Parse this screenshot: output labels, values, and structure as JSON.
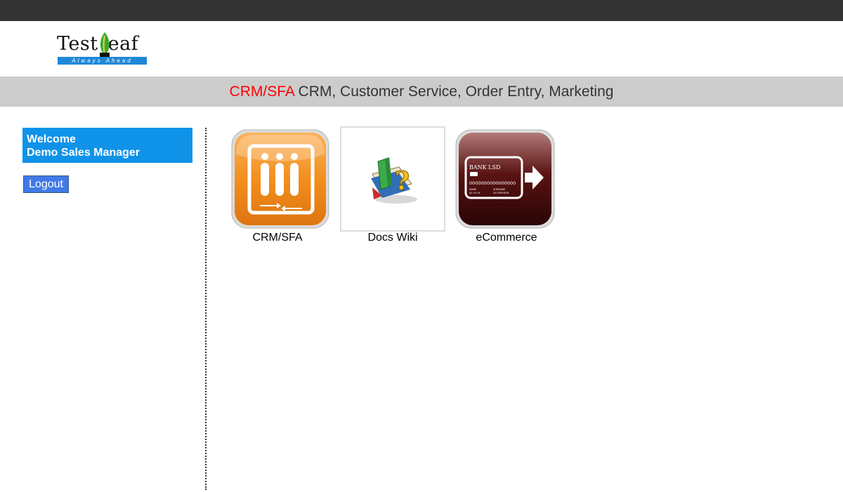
{
  "logo": {
    "word": "TestLeaf",
    "word_before_leaf": "Test",
    "word_after_leaf": "eaf",
    "tagline": "Always Ahead"
  },
  "banner": {
    "highlight": "CRM/SFA",
    "rest": " CRM, Customer Service, Order Entry, Marketing",
    "highlight_color": "#ff0000"
  },
  "sidebar": {
    "welcome_line1": "Welcome",
    "welcome_line2": "Demo Sales Manager",
    "logout_label": "Logout",
    "welcome_bg": "#0f93e8",
    "logout_bg": "#4179e7"
  },
  "apps": [
    {
      "label": "CRM/SFA",
      "icon": "crm-sfa-icon",
      "color": "#f08c1b"
    },
    {
      "label": "Docs Wiki",
      "icon": "docs-wiki-icon",
      "color": "#ffffff"
    },
    {
      "label": "eCommerce",
      "icon": "ecommerce-icon",
      "color": "#6b1a1a",
      "card": {
        "bank": "BANK LSD",
        "number": "0000000000000000",
        "name_label": "NAME",
        "surname_label": "SURNAME",
        "name_value": "00 43 34",
        "surname_value": "0437893678"
      }
    }
  ]
}
